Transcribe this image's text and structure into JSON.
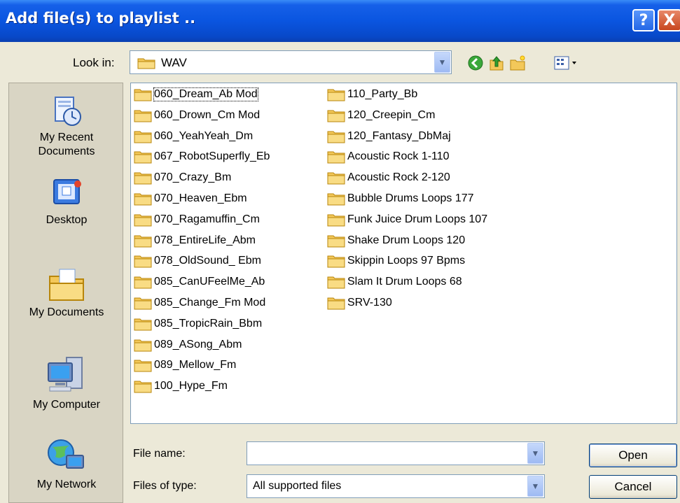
{
  "window": {
    "title": "Add file(s) to playlist .."
  },
  "titlebar_buttons": {
    "help": "?",
    "close": "X"
  },
  "lookin": {
    "label": "Look in:",
    "value": "WAV"
  },
  "toolbar": [
    "back-icon",
    "up-folder-icon",
    "new-folder-icon",
    "view-menu-icon"
  ],
  "places": [
    {
      "label": "My Recent\nDocuments",
      "icon": "recent-documents-icon"
    },
    {
      "label": "Desktop",
      "icon": "desktop-icon"
    },
    {
      "label": "My Documents",
      "icon": "my-documents-icon"
    },
    {
      "label": "My Computer",
      "icon": "my-computer-icon"
    },
    {
      "label": "My Network",
      "icon": "my-network-icon"
    }
  ],
  "files": [
    "060_Dream_Ab Mod",
    "060_Drown_Cm Mod",
    "060_YeahYeah_Dm",
    "067_RobotSuperfly_Eb",
    "070_Crazy_Bm",
    "070_Heaven_Ebm",
    "070_Ragamuffin_Cm",
    "078_EntireLife_Abm",
    "078_OldSound_ Ebm",
    "085_CanUFeelMe_Ab",
    "085_Change_Fm Mod",
    "085_TropicRain_Bbm",
    "089_ASong_Abm",
    "089_Mellow_Fm",
    "100_Hype_Fm",
    "110_Party_Bb",
    "120_Creepin_Cm",
    "120_Fantasy_DbMaj",
    "Acoustic Rock 1-110",
    "Acoustic Rock 2-120",
    "Bubble Drums Loops 177",
    "Funk Juice Drum Loops 107",
    "Shake Drum Loops 120",
    "Skippin Loops 97 Bpms",
    "Slam It Drum Loops 68",
    "SRV-130"
  ],
  "filename": {
    "label": "File name:",
    "value": ""
  },
  "filetype": {
    "label": "Files of type:",
    "value": "All supported files"
  },
  "buttons": {
    "open": "Open",
    "cancel": "Cancel"
  },
  "colors": {
    "titlebar": "#0a55e0",
    "dialog_bg": "#ece9d8",
    "folder": "#f3c85a"
  }
}
